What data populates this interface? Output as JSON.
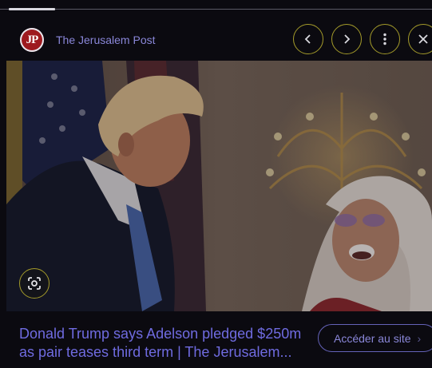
{
  "source": {
    "logo_text": "JP",
    "name": "The Jerusalem Post"
  },
  "controls": {
    "prev_icon": "chevron-left-icon",
    "next_icon": "chevron-right-icon",
    "more_icon": "more-vert-icon",
    "close_icon": "close-icon"
  },
  "image": {
    "lens_icon": "google-lens-icon"
  },
  "headline": {
    "line1": "Donald Trump says Adelson pledged $250m",
    "line2": "as pair teases third term | The Jerusalem..."
  },
  "visit_button": {
    "label": "Accéder au site",
    "icon": "chevron-right-icon"
  },
  "colors": {
    "accent_text": "#6f6be0",
    "focus_ring": "#a39a2a",
    "background": "#0b0a10"
  }
}
